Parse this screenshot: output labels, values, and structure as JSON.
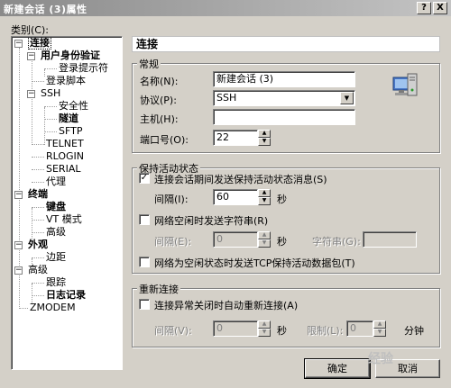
{
  "window": {
    "title": "新建会话 (3)属性",
    "help_btn": "?",
    "close_btn": "X"
  },
  "category_label": "类别(C):",
  "tree": {
    "connection": "连接",
    "user_auth": "用户身份验证",
    "login_prompt": "登录提示符",
    "login_script": "登录脚本",
    "ssh": "SSH",
    "security": "安全性",
    "tunnel": "隧道",
    "sftp": "SFTP",
    "telnet": "TELNET",
    "rlogin": "RLOGIN",
    "serial": "SERIAL",
    "proxy": "代理",
    "terminal": "终端",
    "keyboard": "键盘",
    "vt_mode": "VT 模式",
    "advanced_t": "高级",
    "appearance": "外观",
    "margin": "边距",
    "advanced": "高级",
    "trace": "跟踪",
    "log": "日志记录",
    "zmodem": "ZMODEM"
  },
  "panel_title": "连接",
  "general": {
    "legend": "常规",
    "name_label": "名称(N):",
    "name_value": "新建会话 (3)",
    "protocol_label": "协议(P):",
    "protocol_value": "SSH",
    "host_label": "主机(H):",
    "host_value": "",
    "port_label": "端口号(O):",
    "port_value": "22"
  },
  "keepalive": {
    "legend": "保持活动状态",
    "send_keepalive_label": "连接会话期间发送保持活动状态消息(S)",
    "send_keepalive_checked": true,
    "interval_label": "间隔(I):",
    "interval_value": "60",
    "interval_unit": "秒",
    "idle_string_label": "网络空闲时发送字符串(R)",
    "idle_interval_label": "间隔(E):",
    "idle_interval_value": "0",
    "idle_unit": "秒",
    "string_label": "字符串(G):",
    "tcp_keepalive_label": "网络为空闲状态时发送TCP保持活动数据包(T)"
  },
  "reconnect": {
    "legend": "重新连接",
    "auto_label": "连接异常关闭时自动重新连接(A)",
    "interval_label": "间隔(V):",
    "interval_value": "0",
    "interval_unit": "秒",
    "limit_label": "限制(L):",
    "limit_value": "0",
    "limit_unit": "分钟"
  },
  "buttons": {
    "ok": "确定",
    "cancel": "取消"
  },
  "watermark": "经验"
}
